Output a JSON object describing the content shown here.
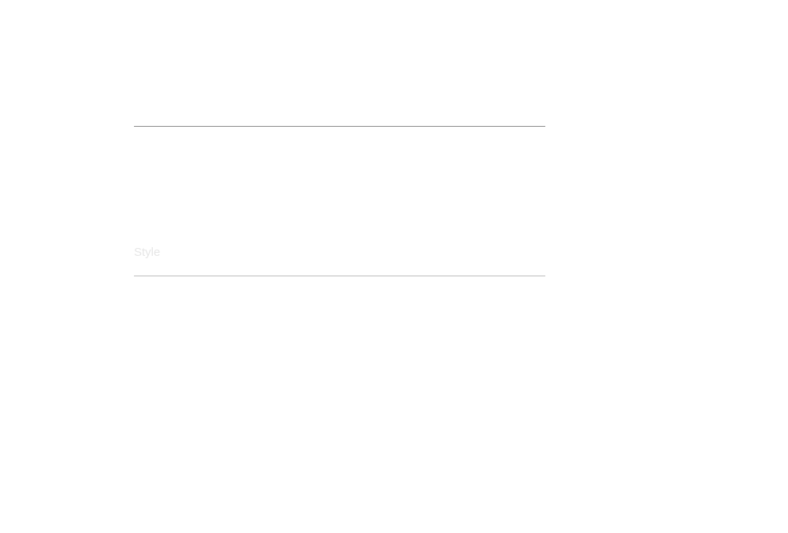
{
  "form": {
    "style_label": "Style"
  },
  "colors": {
    "background": "#ffffff",
    "top_divider": "#8a8a8a",
    "bottom_divider": "#bdbdbd",
    "label_text": "#e6e6e6"
  }
}
